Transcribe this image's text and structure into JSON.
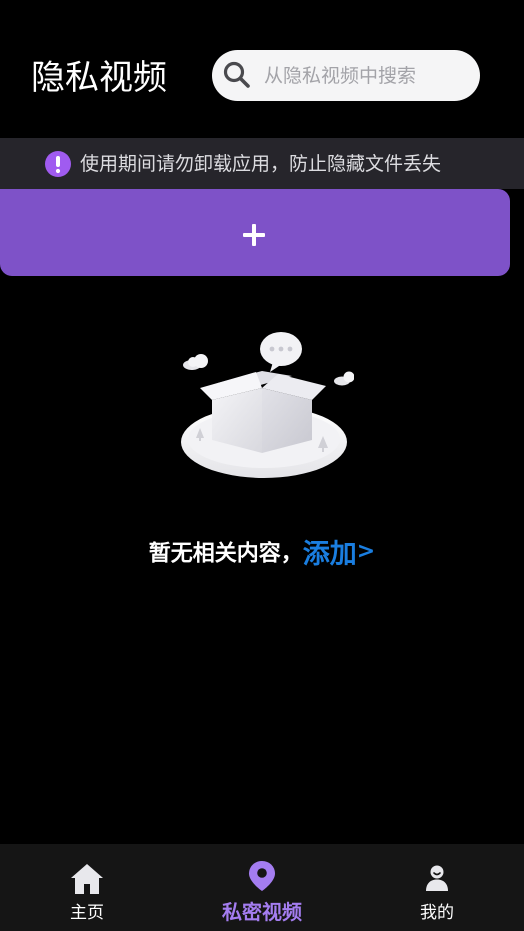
{
  "header": {
    "title": "隐私视频",
    "search_placeholder": "从隐私视频中搜索",
    "search_icon": "search-icon"
  },
  "warning": {
    "text": "使用期间请勿卸载应用，防止隐藏文件丢失",
    "icon": "exclamation-icon",
    "icon_color": "#a05bf0"
  },
  "add_bar": {
    "label": "+",
    "color": "#7e52c8"
  },
  "empty_state": {
    "text": "暂无相关内容，",
    "link": "添加",
    "link_arrow": ">",
    "link_color": "#1a7ee0",
    "illustration": "empty-box-illustration"
  },
  "bottom_nav": {
    "items": [
      {
        "label": "主页",
        "icon": "home-icon",
        "active": false
      },
      {
        "label": "私密视频",
        "icon": "location-pin-icon",
        "active": true
      },
      {
        "label": "我的",
        "icon": "person-icon",
        "active": false
      }
    ],
    "active_color": "#a47df0",
    "inactive_color": "#ffffff"
  }
}
